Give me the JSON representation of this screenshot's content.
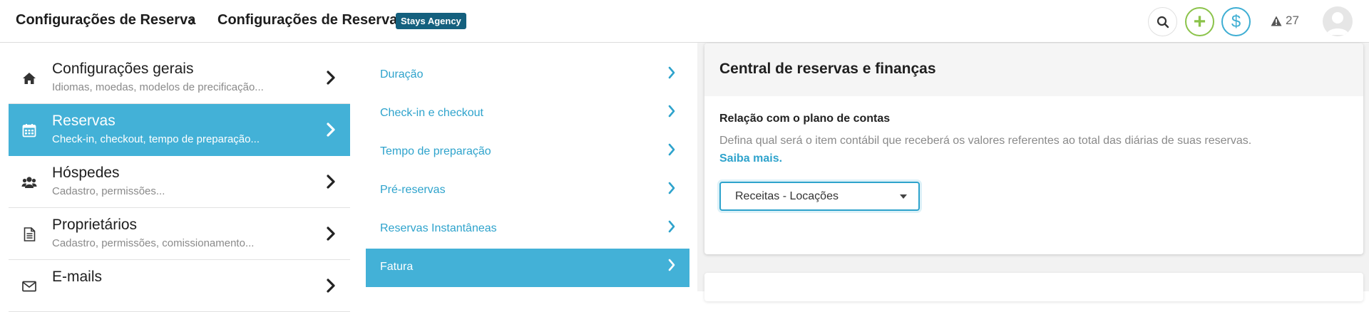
{
  "header": {
    "breadcrumb": [
      "Configurações de Reserva",
      "Configurações de Reserva"
    ],
    "separator": "›",
    "badge": "Stays Agency",
    "add_icon_glyph": "+",
    "money_icon_glyph": "$",
    "alerts_count": "27"
  },
  "menu": {
    "items": [
      {
        "title": "Configurações gerais",
        "subtitle": "Idiomas, moedas, modelos de precificação...",
        "icon": "home-icon"
      },
      {
        "title": "Reservas",
        "subtitle": "Check-in, checkout, tempo de preparação...",
        "icon": "calendar-icon"
      },
      {
        "title": "Hóspedes",
        "subtitle": "Cadastro, permissões...",
        "icon": "users-icon"
      },
      {
        "title": "Proprietários",
        "subtitle": "Cadastro, permissões, comissionamento...",
        "icon": "document-icon"
      },
      {
        "title": "E-mails",
        "subtitle": "",
        "icon": "envelope-icon"
      }
    ]
  },
  "submenu": {
    "items": [
      {
        "label": "Duração"
      },
      {
        "label": "Check-in e checkout"
      },
      {
        "label": "Tempo de preparação"
      },
      {
        "label": "Pré-reservas"
      },
      {
        "label": "Reservas Instantâneas"
      },
      {
        "label": "Fatura"
      }
    ]
  },
  "panel": {
    "title": "Central de reservas e finanças",
    "field_label": "Relação com o plano de contas",
    "field_description": "Defina qual será o item contábil que receberá os valores referentes ao total das diárias de suas reservas.",
    "learn_more": "Saiba mais.",
    "select_value": "Receitas - Locações"
  },
  "colors": {
    "accent": "#43b1d7",
    "link": "#2ea3cc",
    "badge": "#14607e",
    "add_green": "#8bc34a"
  }
}
